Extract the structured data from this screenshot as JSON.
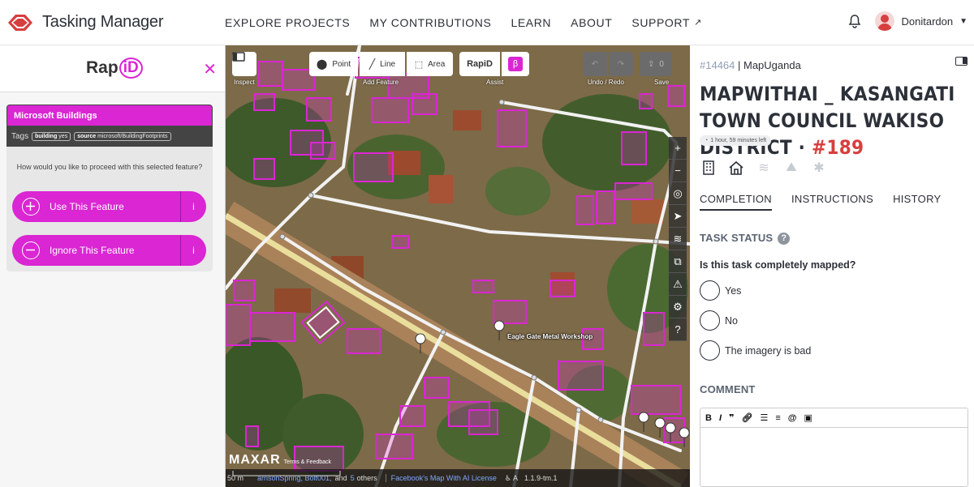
{
  "app": {
    "title": "Tasking Manager",
    "logo_badge": "HOT"
  },
  "nav": [
    "EXPLORE PROJECTS",
    "MY CONTRIBUTIONS",
    "LEARN",
    "ABOUT",
    "SUPPORT"
  ],
  "user": {
    "name": "Donitardon"
  },
  "rapid": {
    "logo_text": "Rap",
    "logo_id": "iD",
    "panel_title": "Microsoft Buildings",
    "tags_label": "Tags",
    "tags": [
      {
        "key": "building",
        "value": "yes"
      },
      {
        "key": "source",
        "value": "microsoft/BuildingFootprints"
      }
    ],
    "question": "How would you like to proceed with this selected feature?",
    "use_label": "Use This Feature",
    "ignore_label": "Ignore This Feature",
    "info_icon": "i"
  },
  "map_toolbar": {
    "inspect_label": "Inspect",
    "point_label": "Point",
    "line_label": "Line",
    "area_label": "Area",
    "add_feature_label": "Add Feature",
    "assist_rapid": "RapiD",
    "assist_beta": "β",
    "assist_label": "Assist",
    "undo_redo_label": "Undo / Redo",
    "save_label": "Save",
    "save_count": "0"
  },
  "map": {
    "poi_label": "Eagle Gate Metal Workshop",
    "imagery": "MAXAR",
    "imagery_terms": "Terms & Feedback",
    "scale": "50 m",
    "contributors_1": "arrisonSpring, Bolt001,",
    "contributors_and": "and",
    "contributors_count": "5",
    "contributors_others": "others",
    "license": "Facebook's Map With AI License",
    "version": "1.1.9-tm.1",
    "colors": {
      "building": "#da26d3",
      "road": "#f2f2f2",
      "primary_road": "#f6efa8"
    }
  },
  "project": {
    "id": "#14464",
    "org": "MapUganda",
    "title": "MAPWITHAI _ KASANGATI TOWN COUNCIL WAKISO DISTRICT ·",
    "task_number": "#189",
    "time_left": "1 hour, 59 minutes left",
    "tabs": [
      "COMPLETION",
      "INSTRUCTIONS",
      "HISTORY"
    ],
    "task_status_label": "TASK STATUS",
    "question": "Is this task completely mapped?",
    "options": [
      "Yes",
      "No",
      "The imagery is bad"
    ],
    "comment_label": "COMMENT"
  }
}
